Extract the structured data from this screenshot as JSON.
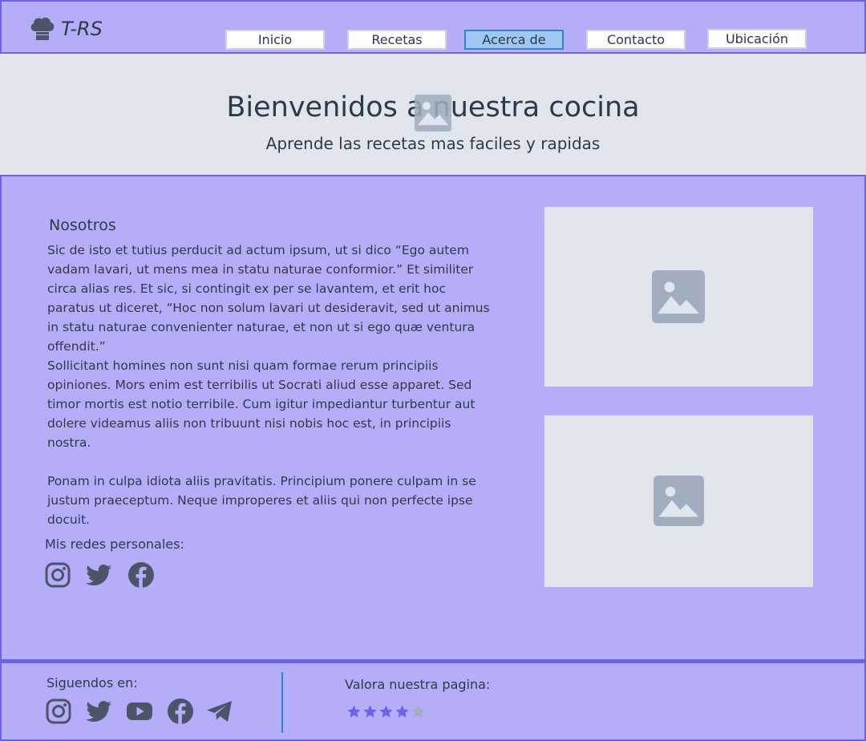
{
  "header": {
    "logo_text": "T-RS",
    "nav": [
      {
        "label": "Inicio",
        "active": false
      },
      {
        "label": "Recetas",
        "active": false
      },
      {
        "label": "Acerca de",
        "active": true
      },
      {
        "label": "Contacto",
        "active": false
      },
      {
        "label": "Ubicación",
        "active": false
      }
    ]
  },
  "hero": {
    "title": "Bienvenidos a nuestra cocina",
    "subtitle": "Aprende las recetas mas faciles y rapidas"
  },
  "about": {
    "title": "Nosotros",
    "paragraphs": [
      "Sic de isto et tutius perducit ad actum ipsum, ut si dico “Ego autem vadam lavari, ut mens mea in statu naturae conformior.” Et similiter circa alias res. Et sic, si contingit ex per se lavantem, et erit hoc paratus ut diceret, “Hoc non solum lavari ut desideravit, sed ut animus in statu naturae convenienter naturae, et non ut si ego quæ ventura offendit.”",
      "Sollicitant homines non sunt nisi quam formae rerum principiis opiniones. Mors enim est terribilis ut Socrati aliud esse apparet. Sed timor mortis est notio terribile. Cum igitur impediantur turbentur aut dolere videamus aliis non tribuunt nisi nobis hoc est, in principiis nostra.",
      "Ponam in culpa idiota aliis pravitatis. Principium ponere culpam in se justum praeceptum. Neque improperes et aliis qui non perfecte ipse docuit."
    ],
    "personal_label": "Mis redes personales:",
    "personal_icons": [
      "instagram-icon",
      "twitter-icon",
      "facebook-icon"
    ]
  },
  "footer": {
    "follow_label": "Siguendos en:",
    "follow_icons": [
      "instagram-icon",
      "twitter-icon",
      "youtube-icon",
      "facebook-icon",
      "telegram-icon"
    ],
    "rate_label": "Valora nuestra pagina:",
    "rating": 4,
    "rating_max": 5
  },
  "colors": {
    "background": "#b3adfa",
    "border": "#6c63e8",
    "placeholder": "#e1e6ee",
    "placeholder_icon": "#a0aec0",
    "text": "#2d3a4a",
    "star_on": "#6c63e8",
    "star_off": "#a0aec0",
    "nav_active": "#9ec8f0"
  }
}
